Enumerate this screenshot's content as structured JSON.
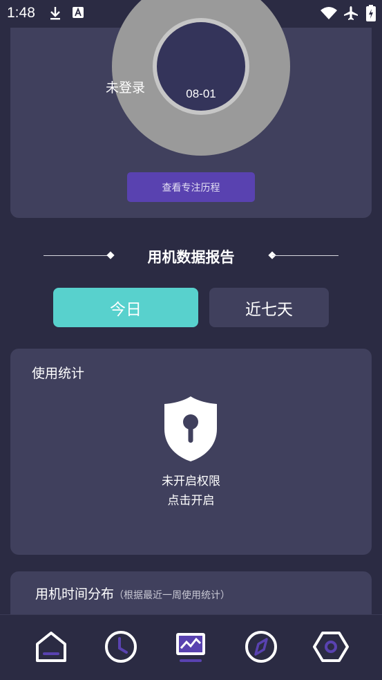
{
  "status_bar": {
    "time": "1:48"
  },
  "focus_card": {
    "date": "08-01",
    "login_status": "未登录",
    "history_button": "查看专注历程"
  },
  "report": {
    "title": "用机数据报告",
    "tabs": [
      {
        "label": "今日",
        "active": true
      },
      {
        "label": "近七天",
        "active": false
      }
    ]
  },
  "usage_stats": {
    "title": "使用统计",
    "permission_line1": "未开启权限",
    "permission_line2": "点击开启"
  },
  "distribution": {
    "title": "用机时间分布",
    "note": "（根据最近一周使用统计）"
  },
  "bottom_nav": {
    "items": [
      {
        "icon": "home-icon",
        "active": false
      },
      {
        "icon": "clock-icon",
        "active": false
      },
      {
        "icon": "chart-icon",
        "active": true
      },
      {
        "icon": "compass-icon",
        "active": false
      },
      {
        "icon": "settings-icon",
        "active": false
      }
    ]
  },
  "colors": {
    "background": "#2b2b43",
    "card": "#40405d",
    "accent_teal": "#58d1cd",
    "accent_purple": "#5942b0",
    "ring_gray": "#9a9a9a",
    "ring_inner": "#34345a"
  }
}
